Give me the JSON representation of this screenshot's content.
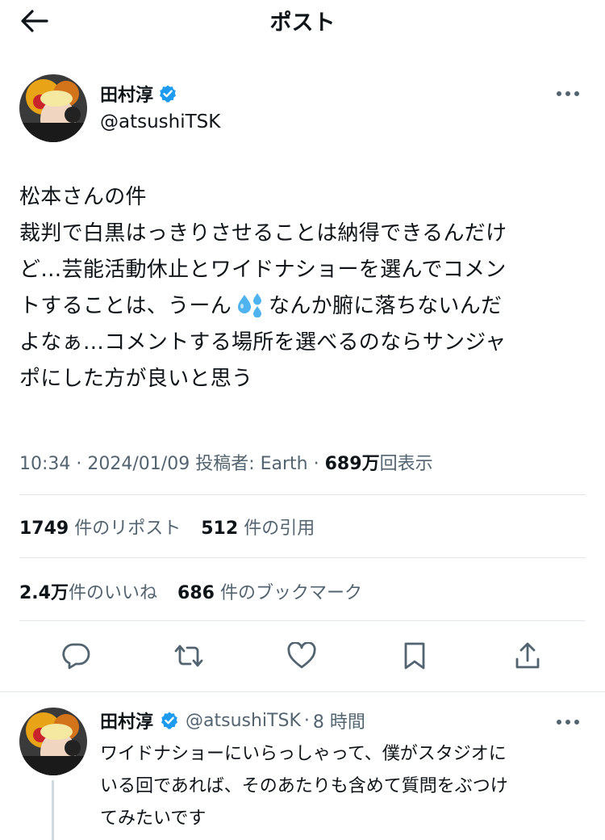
{
  "header": {
    "title": "ポスト"
  },
  "post": {
    "author_name": "田村淳",
    "handle": "@atsushiTSK",
    "body_lines": [
      "松本さんの件",
      "裁判で白黒はっきりさせることは納得できるんだけ",
      "ど…芸能活動休止とワイドナショーを選んでコメン",
      "トすることは、うーん",
      "なんか腑に落ちないんだ",
      "よなぁ…コメントする場所を選べるのならサンジャ",
      "ポにした方が良いと思う"
    ],
    "emoji_icon": "sweat-droplets-icon",
    "time": "10:34",
    "date": "2024/01/09",
    "source_label": "投稿者: Earth",
    "views_count": "689",
    "views_unit": "万",
    "views_label": "回表示"
  },
  "stats": {
    "reposts_count": "1749",
    "reposts_label": "件のリポスト",
    "quotes_count": "512",
    "quotes_label": "件の引用",
    "likes_count": "2.4",
    "likes_unit": "万",
    "likes_label": "件のいいね",
    "bookmarks_count": "686",
    "bookmarks_label": "件のブックマーク"
  },
  "actions": [
    "reply-icon",
    "repost-icon",
    "like-icon",
    "bookmark-icon",
    "share-icon"
  ],
  "reply": {
    "author_name": "田村淳",
    "handle": "@atsushiTSK",
    "separator": "·",
    "time_ago": "8 時間",
    "body_lines": [
      "ワイドナショーにいらっしゃって、僕がスタジオに",
      "いる回であれば、そのあたりも含めて質問をぶつけ",
      "てみたいです"
    ]
  },
  "colors": {
    "text": "#0f1419",
    "secondary": "#536471",
    "verified": "#1d9bf0",
    "divider": "#e3e7ea",
    "thread": "#cfd9de"
  }
}
